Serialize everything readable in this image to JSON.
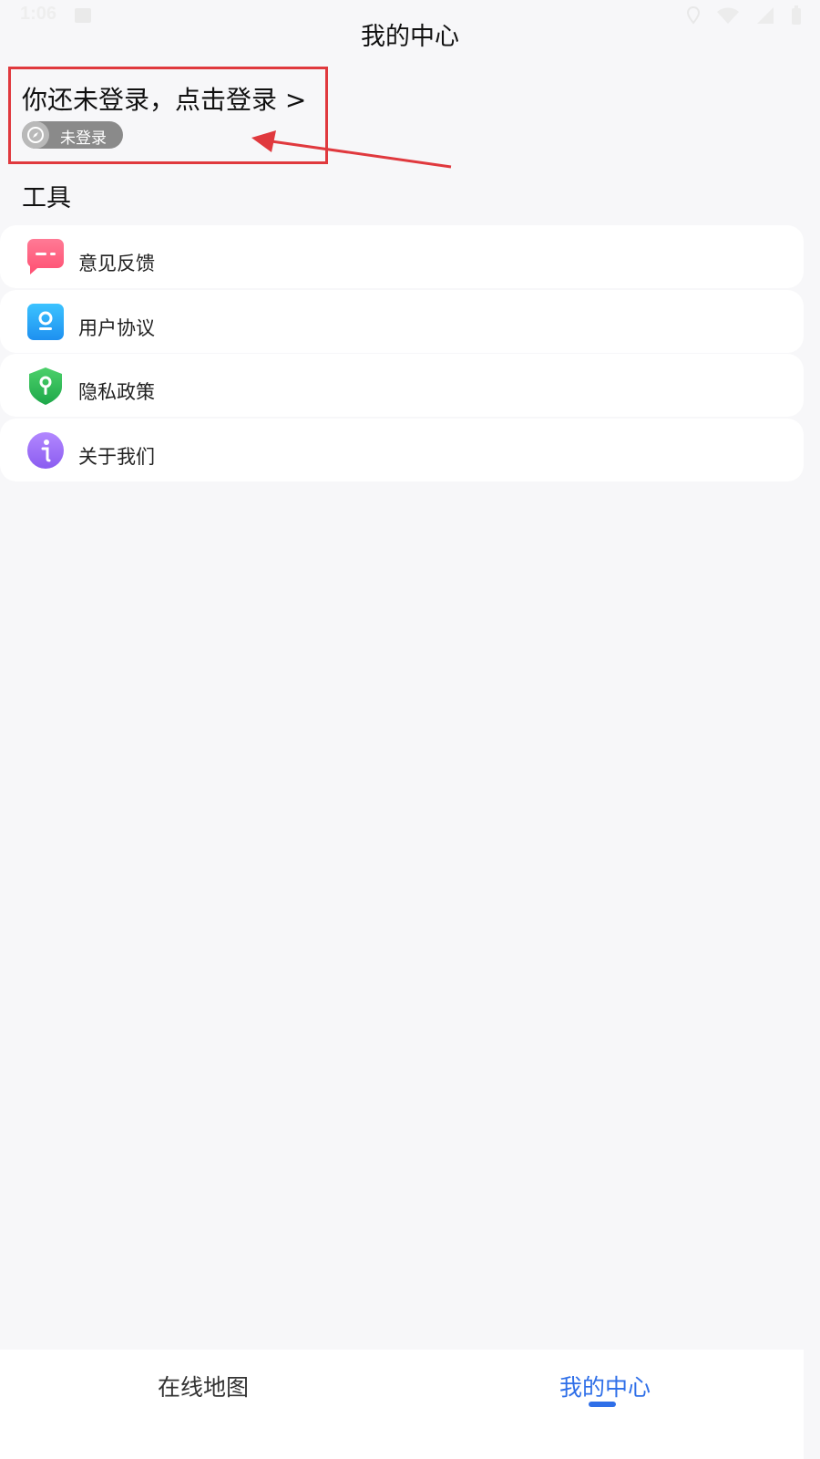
{
  "status_bar": {
    "time": "1:06"
  },
  "header": {
    "title": "我的中心"
  },
  "login": {
    "prompt": "你还未登录，点击登录 >",
    "badge": "未登录"
  },
  "tools": {
    "title": "工具",
    "items": [
      {
        "label": "意见反馈",
        "icon": "feedback-icon"
      },
      {
        "label": "用户协议",
        "icon": "user-agreement-icon"
      },
      {
        "label": "隐私政策",
        "icon": "privacy-shield-icon"
      },
      {
        "label": "关于我们",
        "icon": "info-icon"
      }
    ]
  },
  "bottom_nav": {
    "items": [
      {
        "label": "在线地图"
      },
      {
        "label": "我的中心",
        "active": true
      }
    ]
  },
  "colors": {
    "accent": "#2f6fe8",
    "annotation": "#e0393e",
    "background": "#f7f7f9"
  }
}
